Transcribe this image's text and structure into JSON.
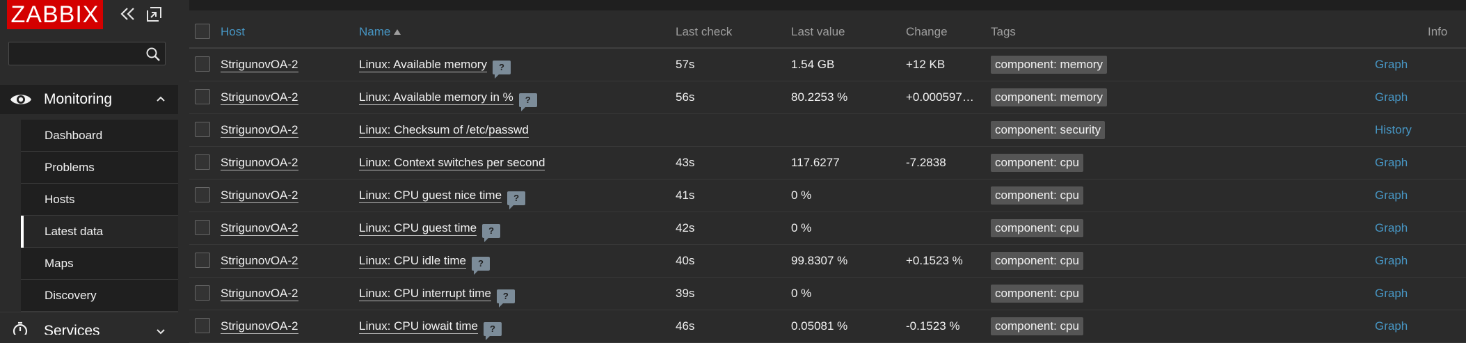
{
  "app": {
    "logo_text": "ZABBIX",
    "brand_color": "#d40000",
    "link_color": "#4796c4"
  },
  "sidebar": {
    "search": {
      "value": "",
      "placeholder": ""
    },
    "icons": {
      "collapse": "double-chevron-left-icon",
      "undock": "undock-icon",
      "search": "search-icon"
    },
    "monitoring": {
      "label": "Monitoring",
      "icon": "eye-icon",
      "expanded": true,
      "items": [
        {
          "label": "Dashboard",
          "active": false
        },
        {
          "label": "Problems",
          "active": false
        },
        {
          "label": "Hosts",
          "active": false
        },
        {
          "label": "Latest data",
          "active": true
        },
        {
          "label": "Maps",
          "active": false
        },
        {
          "label": "Discovery",
          "active": false
        }
      ]
    },
    "services": {
      "label": "Services",
      "icon": "stopwatch-icon"
    }
  },
  "table": {
    "headers": {
      "host": "Host",
      "name": "Name",
      "name_sort": "ascending",
      "last_check": "Last check",
      "last_value": "Last value",
      "change": "Change",
      "tags": "Tags",
      "info": "Info"
    },
    "rows": [
      {
        "host": "StrigunovOA-2",
        "name": "Linux: Available memory",
        "has_help": true,
        "last_check": "57s",
        "last_value": "1.54 GB",
        "change": "+12 KB",
        "tag": "component: memory",
        "action": "Graph"
      },
      {
        "host": "StrigunovOA-2",
        "name": "Linux: Available memory in %",
        "has_help": true,
        "last_check": "56s",
        "last_value": "80.2253 %",
        "change": "+0.000597…",
        "tag": "component: memory",
        "action": "Graph"
      },
      {
        "host": "StrigunovOA-2",
        "name": "Linux: Checksum of /etc/passwd",
        "has_help": false,
        "last_check": "",
        "last_value": "",
        "change": "",
        "tag": "component: security",
        "action": "History"
      },
      {
        "host": "StrigunovOA-2",
        "name": "Linux: Context switches per second",
        "has_help": false,
        "last_check": "43s",
        "last_value": "117.6277",
        "change": "-7.2838",
        "tag": "component: cpu",
        "action": "Graph"
      },
      {
        "host": "StrigunovOA-2",
        "name": "Linux: CPU guest nice time",
        "has_help": true,
        "last_check": "41s",
        "last_value": "0 %",
        "change": "",
        "tag": "component: cpu",
        "action": "Graph"
      },
      {
        "host": "StrigunovOA-2",
        "name": "Linux: CPU guest time",
        "has_help": true,
        "last_check": "42s",
        "last_value": "0 %",
        "change": "",
        "tag": "component: cpu",
        "action": "Graph"
      },
      {
        "host": "StrigunovOA-2",
        "name": "Linux: CPU idle time",
        "has_help": true,
        "last_check": "40s",
        "last_value": "99.8307 %",
        "change": "+0.1523 %",
        "tag": "component: cpu",
        "action": "Graph"
      },
      {
        "host": "StrigunovOA-2",
        "name": "Linux: CPU interrupt time",
        "has_help": true,
        "last_check": "39s",
        "last_value": "0 %",
        "change": "",
        "tag": "component: cpu",
        "action": "Graph"
      },
      {
        "host": "StrigunovOA-2",
        "name": "Linux: CPU iowait time",
        "has_help": true,
        "last_check": "46s",
        "last_value": "0.05081 %",
        "change": "-0.1523 %",
        "tag": "component: cpu",
        "action": "Graph"
      }
    ],
    "help_glyph": "?"
  }
}
